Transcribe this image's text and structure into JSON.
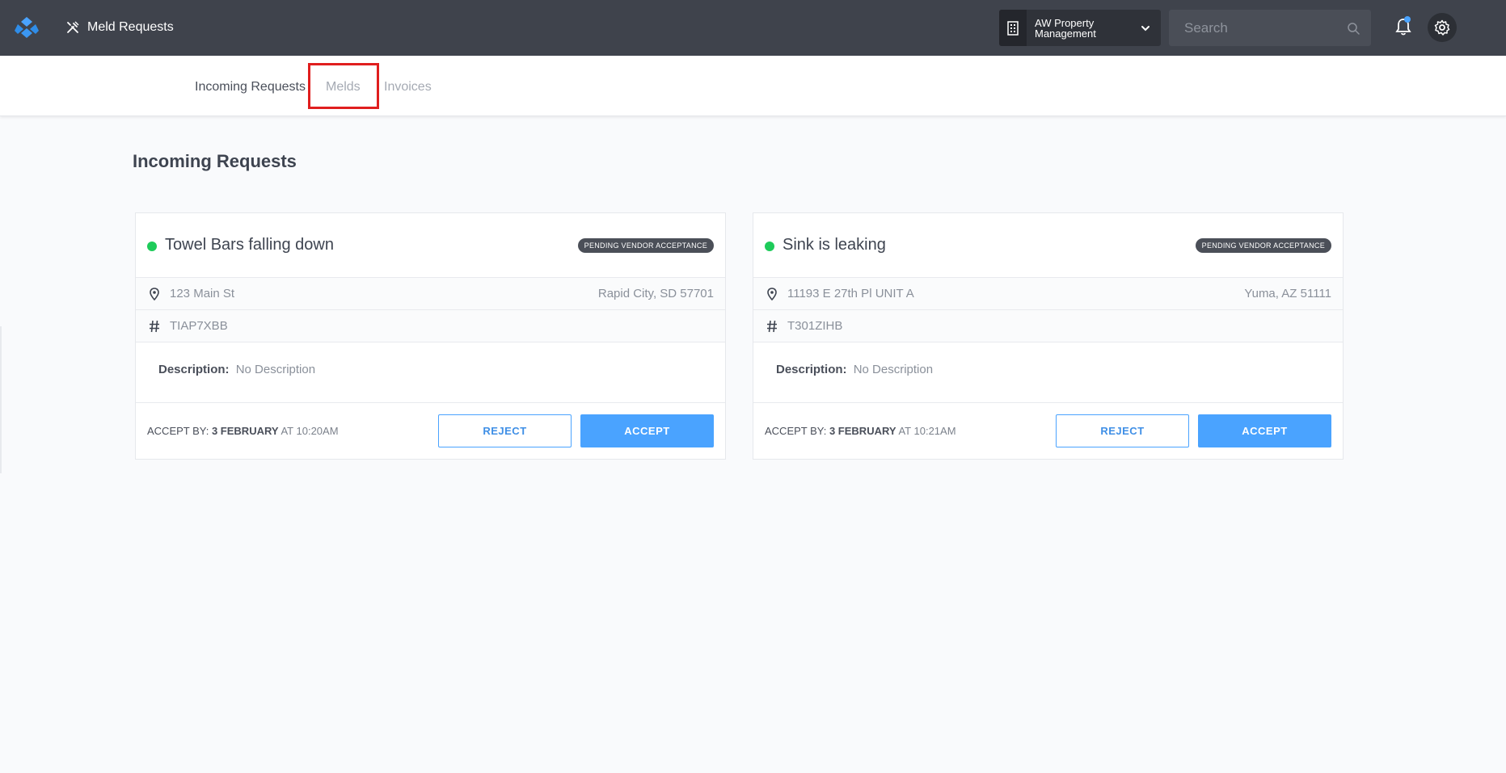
{
  "header": {
    "app_title": "Meld Requests",
    "org_name": "AW Property Management",
    "search_placeholder": "Search"
  },
  "tabs": [
    {
      "label": "Incoming Requests"
    },
    {
      "label": "Melds"
    },
    {
      "label": "Invoices"
    }
  ],
  "page": {
    "title": "Incoming Requests"
  },
  "requests": [
    {
      "title": "Towel Bars falling down",
      "status": "PENDING VENDOR ACCEPTANCE",
      "address": "123 Main St",
      "city": "Rapid City, SD 57701",
      "code": "TIAP7XBB",
      "description_label": "Description:",
      "description": "No Description",
      "accept_by_label": "ACCEPT BY:",
      "accept_by_date": "3 FEBRUARY",
      "accept_by_time": "AT 10:20AM",
      "reject_label": "REJECT",
      "accept_label": "ACCEPT"
    },
    {
      "title": "Sink is leaking",
      "status": "PENDING VENDOR ACCEPTANCE",
      "address": "11193 E 27th Pl UNIT A",
      "city": "Yuma, AZ 51111",
      "code": "T301ZIHB",
      "description_label": "Description:",
      "description": "No Description",
      "accept_by_label": "ACCEPT BY:",
      "accept_by_date": "3 FEBRUARY",
      "accept_by_time": "AT 10:21AM",
      "reject_label": "REJECT",
      "accept_label": "ACCEPT"
    }
  ],
  "colors": {
    "topbar": "#3f434c",
    "accent": "#4aa3ff",
    "status_dot": "#1ecb5a",
    "highlight": "#e01e1e"
  },
  "icons": {
    "logo": "propertymeld-logo",
    "app": "tools-icon",
    "org": "building-icon",
    "search": "search-icon",
    "notifications": "bell-icon",
    "settings": "gear-icon",
    "address": "map-pin-icon",
    "code": "hash-icon"
  }
}
